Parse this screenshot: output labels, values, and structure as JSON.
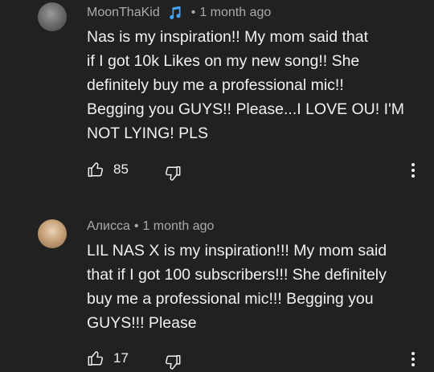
{
  "comments": [
    {
      "author": "MoonThaKid",
      "has_music_badge": true,
      "separator": "•",
      "time": "1 month ago",
      "text": "Nas is my inspiration!! My mom said that\nif I got 10k Likes on my new song!! She\ndefinitely buy me a professional mic!!\nBegging you GUYS!! Please...I LOVE OU! I'M\nNOT LYING! PLS",
      "likes": "85"
    },
    {
      "author": "Алисса",
      "has_music_badge": false,
      "separator": "•",
      "time": "1 month ago",
      "text": "LIL NAS X is my inspiration!!! My mom said\nthat if I got 100 subscribers!!! She definitely\nbuy me a professional mic!!! Begging you\nGUYS!!! Please",
      "likes": "17"
    }
  ],
  "icons": {
    "like": "thumbs-up-icon",
    "dislike": "thumbs-down-icon",
    "more": "more-vertical-icon",
    "music": "music-note-icon"
  },
  "colors": {
    "background": "#212121",
    "text_primary": "#f1f1f1",
    "text_secondary": "#aaaaaa",
    "music_badge": "#3ea6ff"
  }
}
